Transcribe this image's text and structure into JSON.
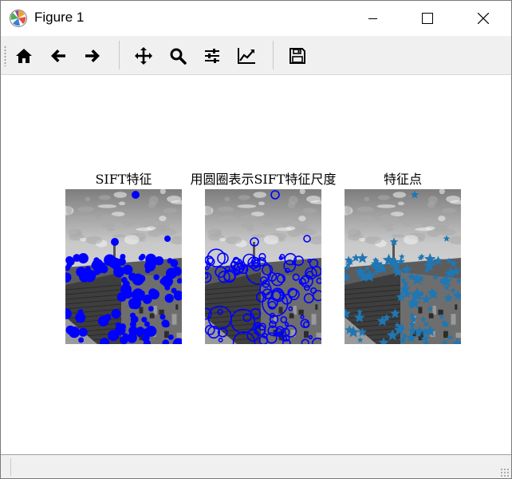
{
  "window": {
    "title": "Figure 1",
    "icon": "matplotlib-icon",
    "controls": [
      "minimize-icon",
      "maximize-icon",
      "close-icon"
    ]
  },
  "toolbar": {
    "buttons": [
      {
        "name": "home-button",
        "icon": "home-icon"
      },
      {
        "name": "back-button",
        "icon": "arrow-left-icon"
      },
      {
        "name": "forward-button",
        "icon": "arrow-right-icon"
      },
      {
        "name": "pan-button",
        "icon": "move-icon"
      },
      {
        "name": "zoom-button",
        "icon": "magnifier-icon"
      },
      {
        "name": "subplots-button",
        "icon": "sliders-icon"
      },
      {
        "name": "edit-axes-button",
        "icon": "line-chart-icon"
      },
      {
        "name": "save-button",
        "icon": "floppy-disk-icon"
      }
    ]
  },
  "figure": {
    "subplots": [
      {
        "title": "SIFT特征",
        "marker_style": "filled-dots",
        "marker_color": "#0000ff"
      },
      {
        "title": "用圆圈表示SIFT特征尺度",
        "marker_style": "open-circles",
        "marker_color": "#0000ff"
      },
      {
        "title": "特征点",
        "marker_style": "star-markers",
        "marker_color": "#1f77b4"
      }
    ]
  },
  "statusbar": {
    "text": ""
  }
}
